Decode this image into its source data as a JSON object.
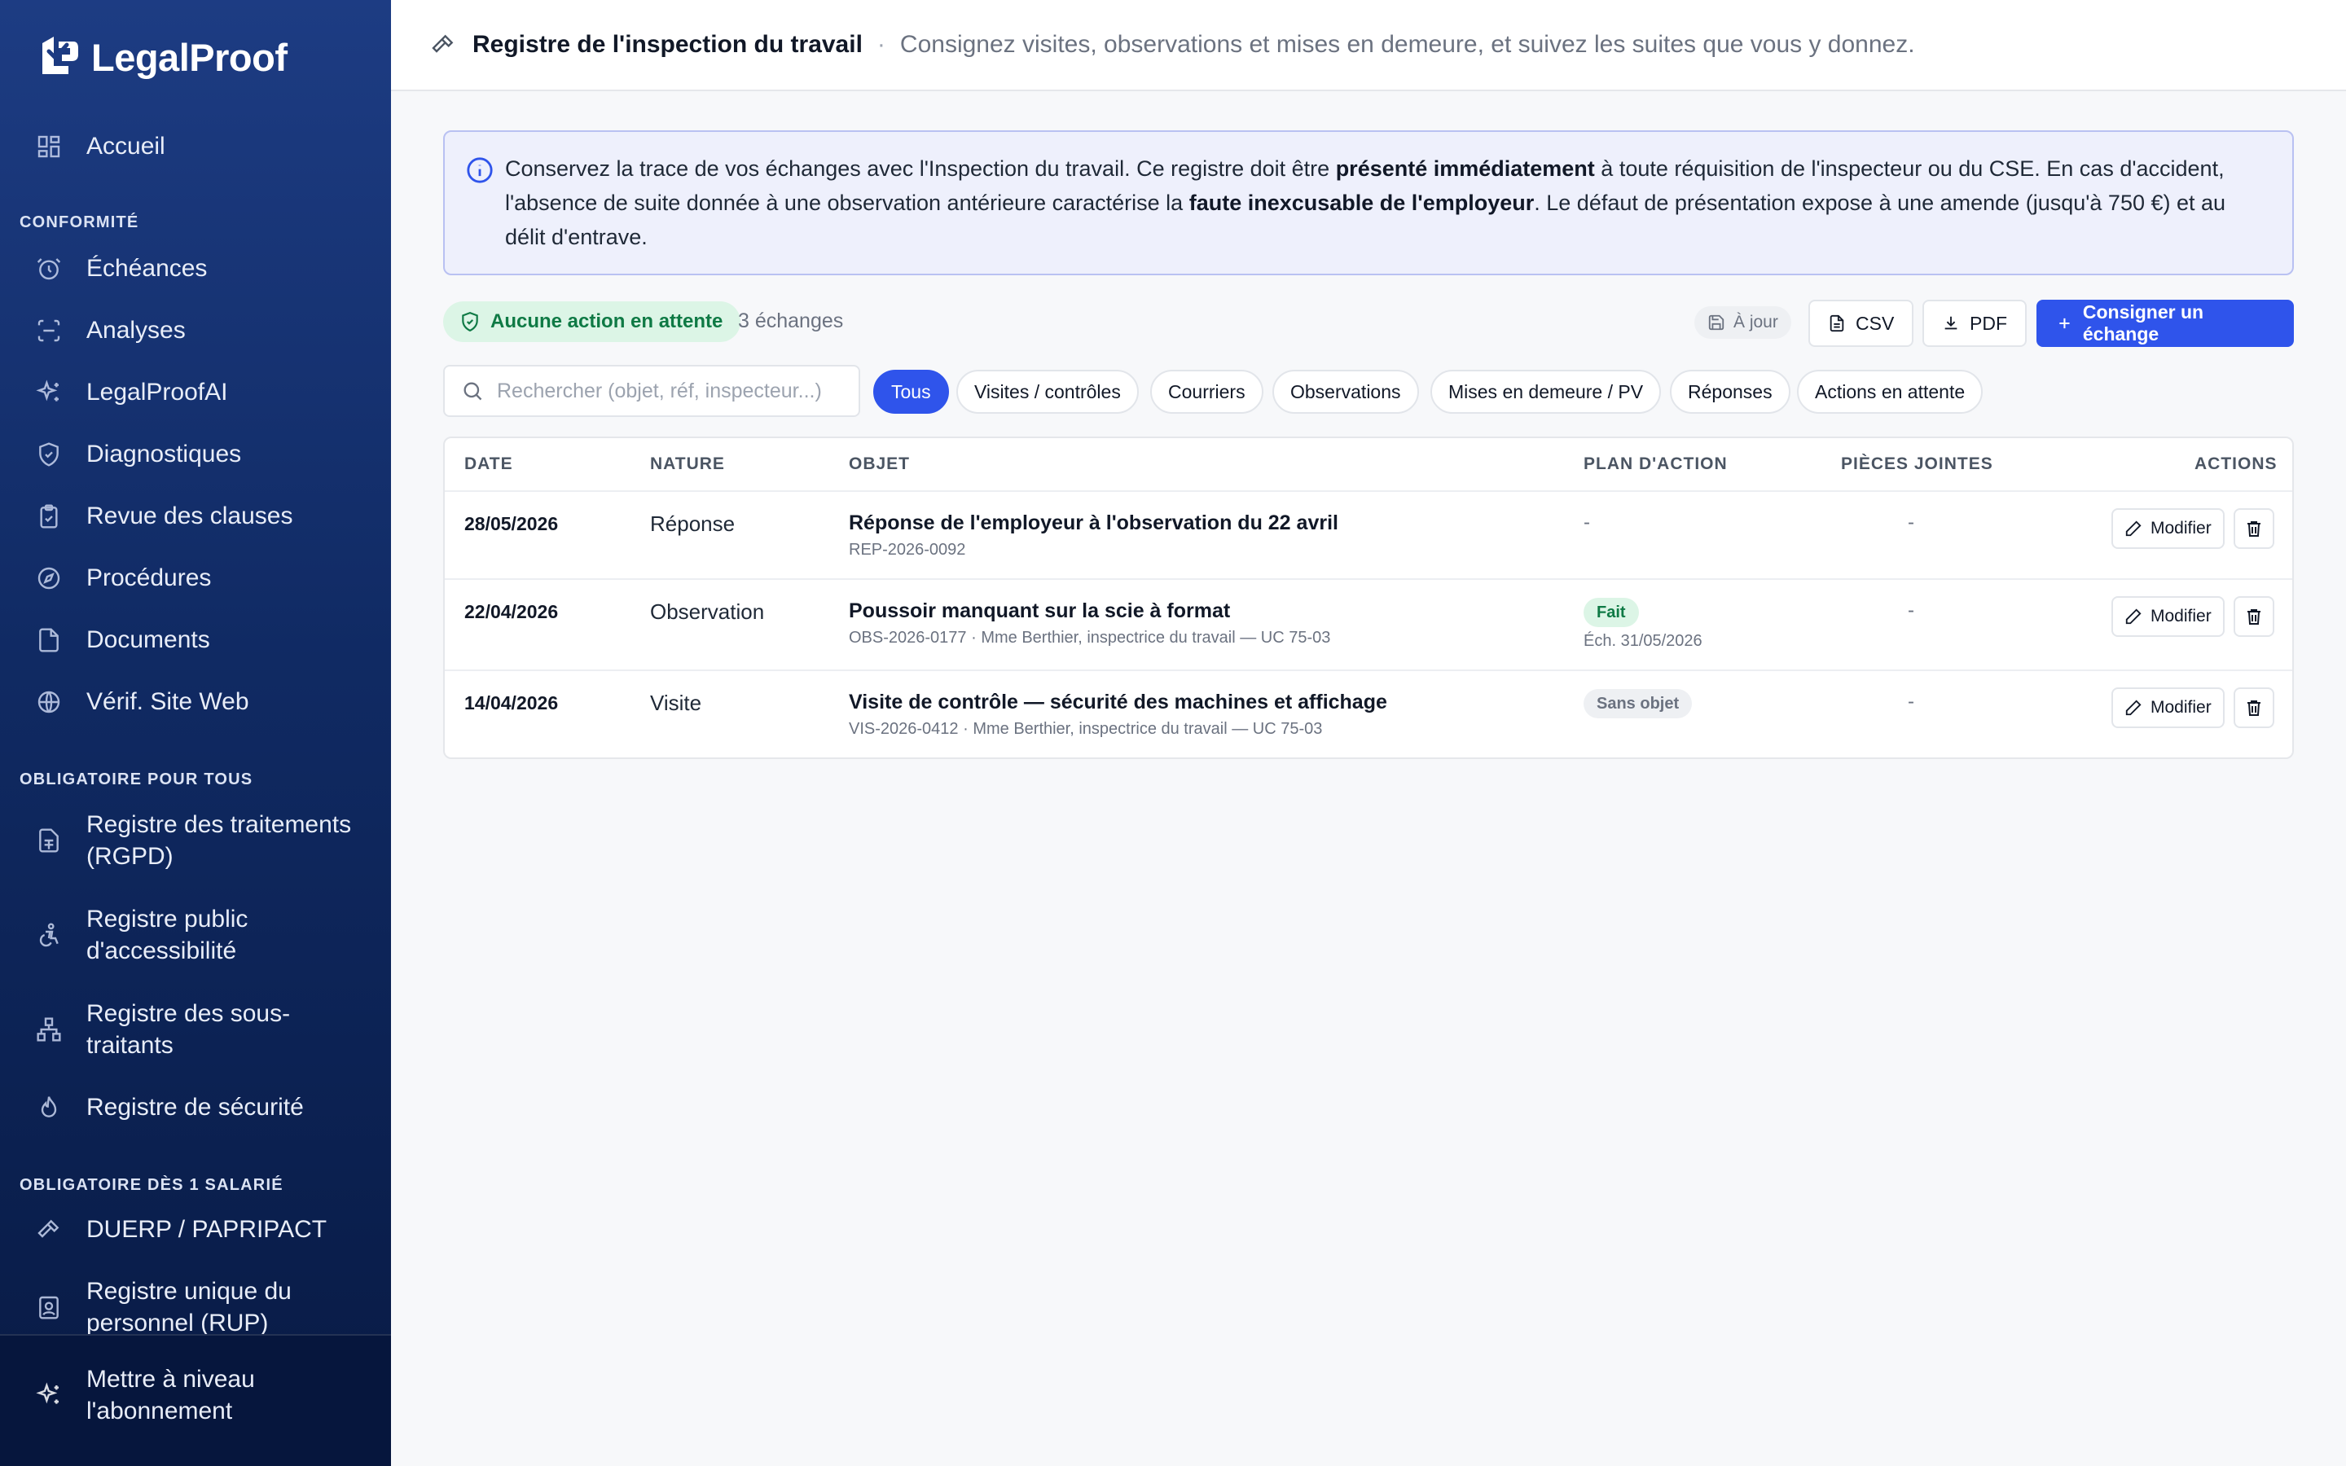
{
  "brand": {
    "name": "LegalProof"
  },
  "sidebar": {
    "home": {
      "label": "Accueil",
      "icon": "dashboard-icon"
    },
    "sections": [
      {
        "title": "CONFORMITÉ",
        "items": [
          {
            "label": "Échéances",
            "icon": "alarm-clock-icon"
          },
          {
            "label": "Analyses",
            "icon": "scan-icon"
          },
          {
            "label": "LegalProofAI",
            "icon": "sparkles-icon"
          },
          {
            "label": "Diagnostiques",
            "icon": "shield-check-icon"
          },
          {
            "label": "Revue des clauses",
            "icon": "clipboard-check-icon"
          },
          {
            "label": "Procédures",
            "icon": "compass-icon"
          },
          {
            "label": "Documents",
            "icon": "file-icon"
          },
          {
            "label": "Vérif. Site Web",
            "icon": "globe-icon"
          }
        ]
      },
      {
        "title": "OBLIGATOIRE POUR TOUS",
        "items": [
          {
            "label_line1": "Registre des traitements",
            "label_line2": "(RGPD)",
            "icon": "file-spreadsheet-icon"
          },
          {
            "label_line1": "Registre public",
            "label_line2": "d'accessibilité",
            "icon": "accessibility-icon"
          },
          {
            "label_line1": "Registre des sous-",
            "label_line2": "traitants",
            "icon": "network-icon"
          },
          {
            "label": "Registre de sécurité",
            "icon": "flame-icon"
          }
        ]
      },
      {
        "title": "OBLIGATOIRE DÈS 1 SALARIÉ",
        "items": [
          {
            "label": "DUERP / PAPRIPACT",
            "icon": "hammer-icon"
          },
          {
            "label_line1": "Registre unique du",
            "label_line2": "personnel (RUP)",
            "icon": "id-badge-icon"
          }
        ]
      }
    ],
    "upgrade": {
      "label_line1": "Mettre à niveau",
      "label_line2": "l'abonnement",
      "icon": "sparkles-icon"
    }
  },
  "header": {
    "icon": "gavel-icon",
    "title": "Registre de l'inspection du travail",
    "separator": "·",
    "subtitle": "Consignez visites, observations et mises en demeure, et suivez les suites que vous y donnez."
  },
  "info": {
    "part1": "Conservez la trace de vos échanges avec l'Inspection du travail. Ce registre doit être ",
    "bold1": "présenté immédiatement",
    "part2": " à toute réquisition de l'inspecteur ou du CSE. En cas d'accident, l'absence de suite donnée à une observation antérieure caractérise la ",
    "bold2": "faute inexcusable de l'employeur",
    "part3": ". Le défaut de présentation expose à une amende (jusqu'à 750 €) et au délit d'entrave."
  },
  "status": {
    "badge": "Aucune action en attente",
    "count": "3 échanges",
    "saved": "À jour"
  },
  "actions": {
    "csv": "CSV",
    "pdf": "PDF",
    "add": "Consigner un échange"
  },
  "search": {
    "placeholder": "Rechercher (objet, réf, inspecteur...)",
    "value": ""
  },
  "filters": [
    "Tous",
    "Visites / contrôles",
    "Courriers",
    "Observations",
    "Mises en demeure / PV",
    "Réponses",
    "Actions en attente"
  ],
  "table": {
    "columns": [
      "DATE",
      "NATURE",
      "OBJET",
      "PLAN D'ACTION",
      "PIÈCES JOINTES",
      "ACTIONS"
    ],
    "rows": [
      {
        "date": "28/05/2026",
        "nature": "Réponse",
        "title": "Réponse de l'employeur à l'observation du 22 avril",
        "ref": "REP-2026-0092",
        "plan": "-",
        "attachments": "-"
      },
      {
        "date": "22/04/2026",
        "nature": "Observation",
        "title": "Poussoir manquant sur la scie à format",
        "ref": "OBS-2026-0177 · Mme Berthier, inspectrice du travail — UC 75-03",
        "plan_tag": "Fait",
        "plan_due": "Éch. 31/05/2026",
        "attachments": "-"
      },
      {
        "date": "14/04/2026",
        "nature": "Visite",
        "title": "Visite de contrôle — sécurité des machines et affichage",
        "ref": "VIS-2026-0412 · Mme Berthier, inspectrice du travail — UC 75-03",
        "plan_tag": "Sans objet",
        "attachments": "-"
      }
    ],
    "edit_label": "Modifier"
  },
  "colors": {
    "accent": "#2f54eb",
    "sidebar_top": "#1d3c83",
    "sidebar_bottom": "#081a44",
    "success_bg": "#dcf5e6",
    "success_text": "#0f7a45",
    "info_bg": "#eef0fc"
  }
}
